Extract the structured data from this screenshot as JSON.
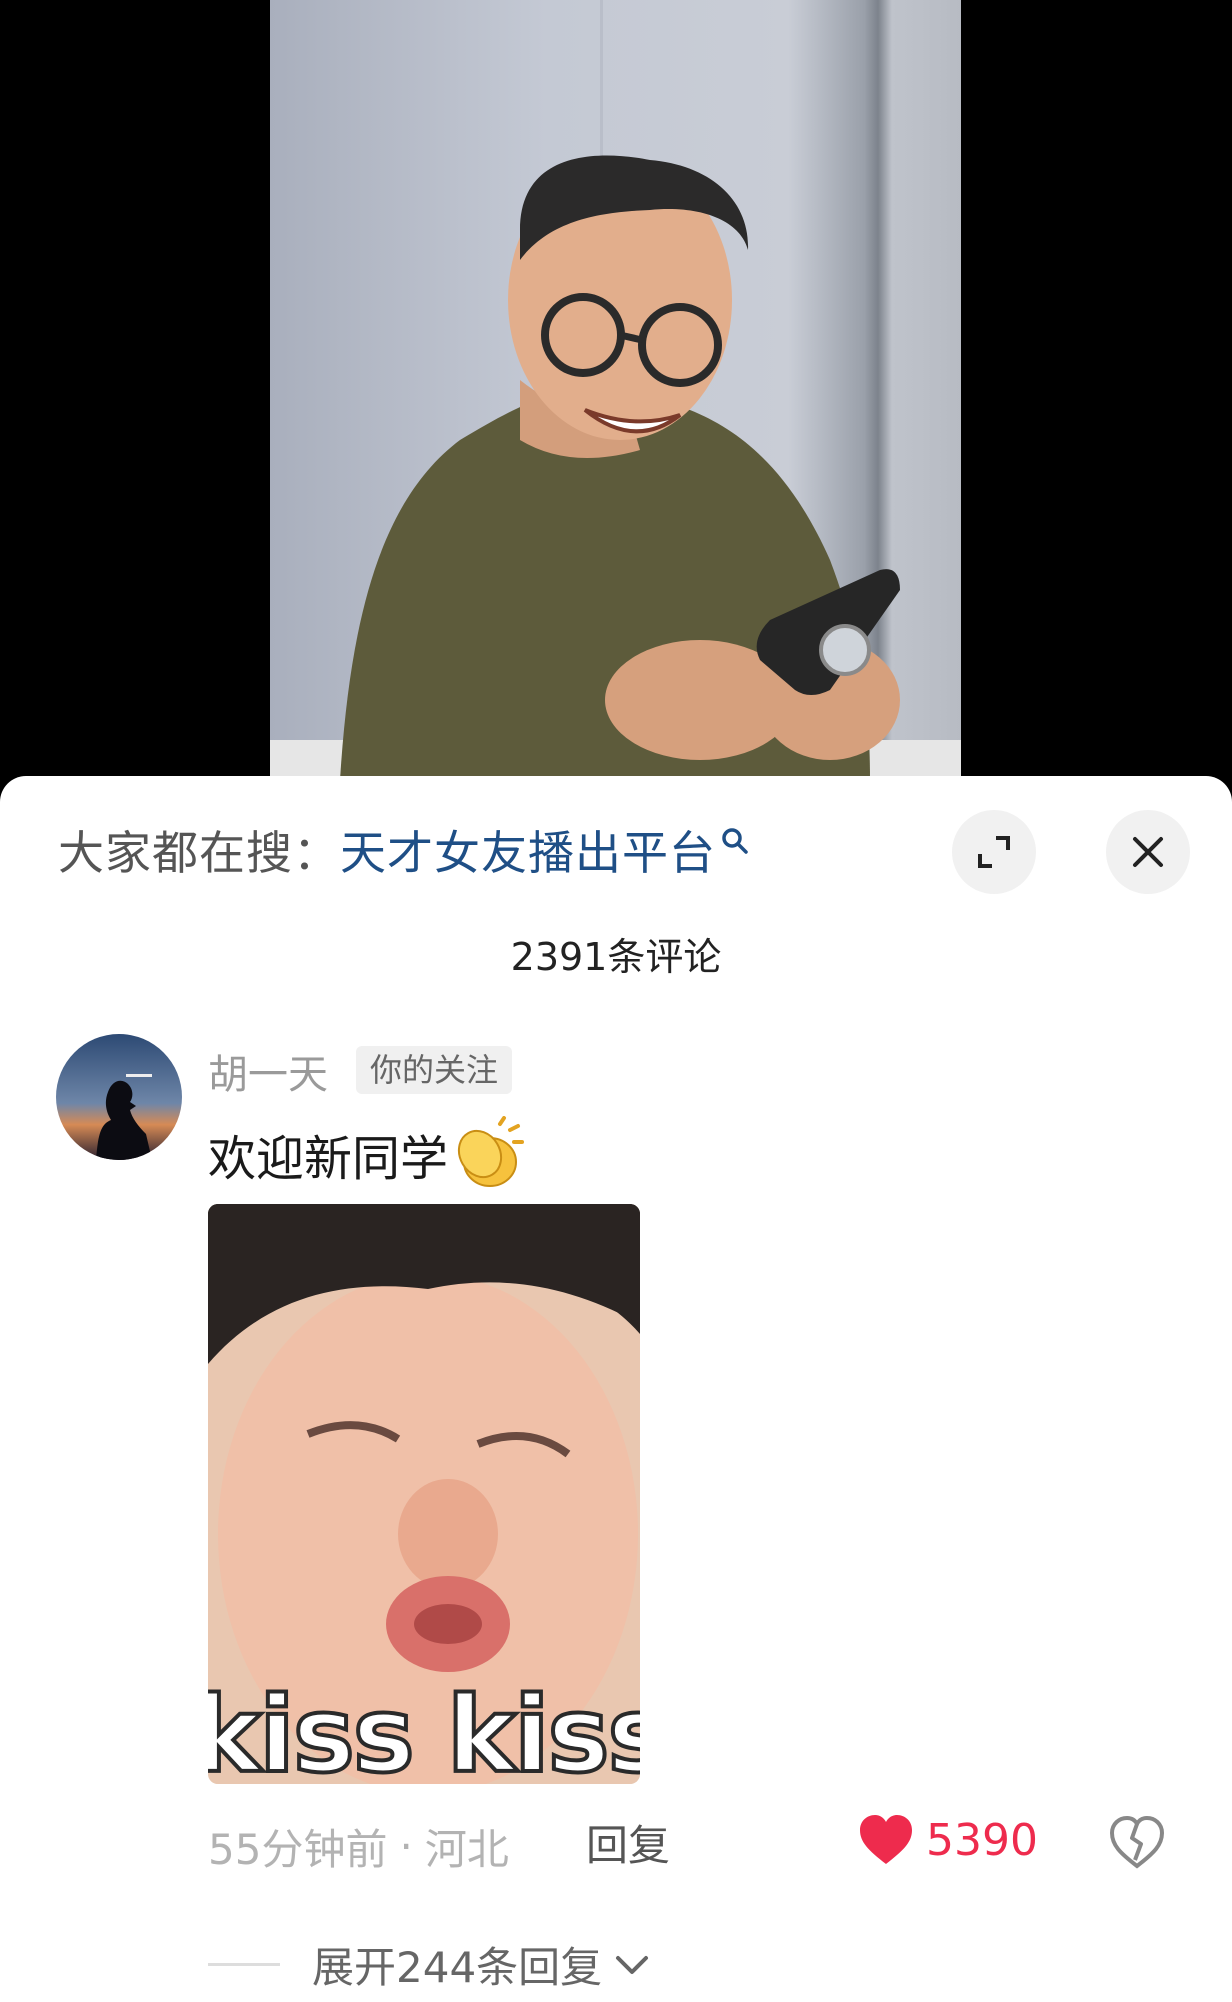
{
  "search": {
    "prefix": "大家都在搜：",
    "term": "天才女友播出平台"
  },
  "comments_header": {
    "count_text": "2391条评论"
  },
  "comment": {
    "username": "胡一天",
    "badge": "你的关注",
    "text": "欢迎新同学",
    "image_caption": "kiss kiss~",
    "time": "55分钟前",
    "location": "河北",
    "reply_label": "回复",
    "like_count": "5390",
    "expand_replies": "展开244条回复"
  },
  "colors": {
    "search_term": "#1f4f86",
    "like": "#ee2b4d"
  }
}
